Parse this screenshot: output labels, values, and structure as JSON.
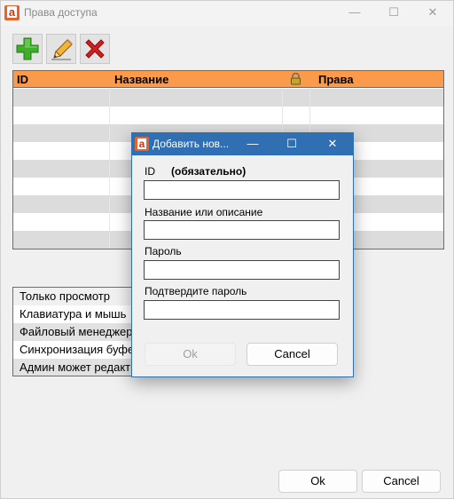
{
  "window": {
    "title": "Права доступа",
    "minimize": "—",
    "maximize": "☐",
    "close": "✕"
  },
  "toolbar": {
    "add_icon": "plus-icon",
    "edit_icon": "pencil-icon",
    "delete_icon": "x-icon",
    "colors": {
      "add": "#3fae2a",
      "delete": "#d02020",
      "pencil": "#f2b43a"
    }
  },
  "table": {
    "columns": {
      "id": "ID",
      "name": "Название",
      "lock_icon": "lock-icon",
      "rights": "Права"
    },
    "header_color": "#fb9a4a"
  },
  "rights": [
    "Только просмотр",
    "Клавиатура и мышь",
    "Файловый менеджер",
    "Синхронизация буфера",
    "Админ может редактировать"
  ],
  "buttons": {
    "ok": "Ok",
    "cancel": "Cancel"
  },
  "dialog": {
    "title": "Добавить нов...",
    "minimize": "—",
    "maximize": "☐",
    "close": "✕",
    "id_label": "ID",
    "id_required": "(обязательно)",
    "id_value": "",
    "name_label": "Название или описание",
    "name_value": "",
    "password_label": "Пароль",
    "password_value": "",
    "confirm_label": "Подтвердите пароль",
    "confirm_value": "",
    "ok": "Ok",
    "cancel": "Cancel",
    "accent": "#2f6fb2"
  }
}
